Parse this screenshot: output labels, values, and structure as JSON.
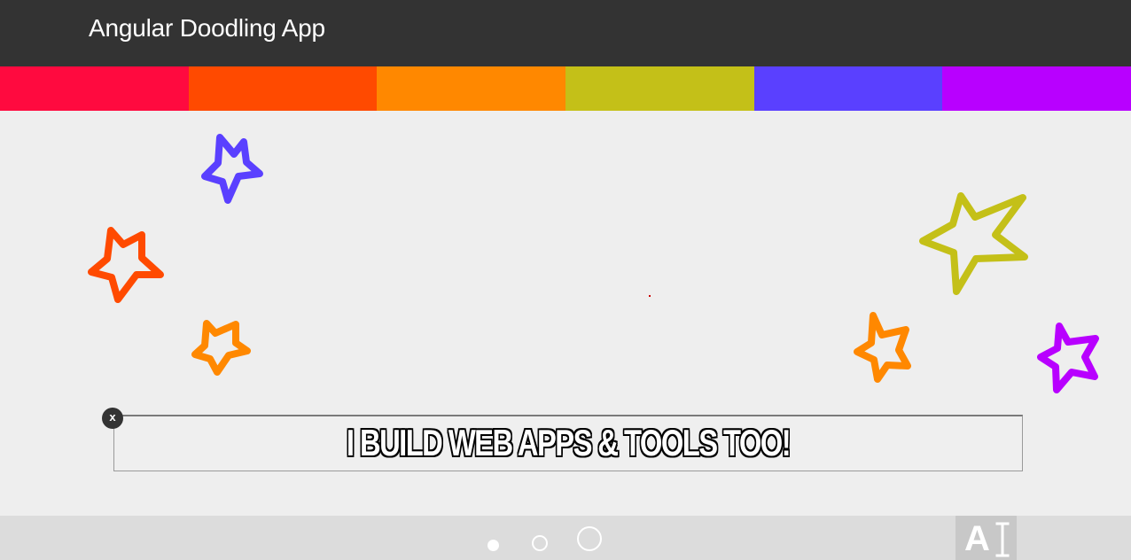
{
  "header": {
    "title": "Angular Doodling App"
  },
  "palette": {
    "colors": [
      "#ff0a3f",
      "#ff4a00",
      "#ff8800",
      "#c4c018",
      "#5a40ff",
      "#b800ff"
    ]
  },
  "canvas": {
    "strokes": [
      {
        "name": "star-blue",
        "color": "#5a40ff"
      },
      {
        "name": "star-red-orange",
        "color": "#ff4a00"
      },
      {
        "name": "star-orange-left",
        "color": "#ff8800"
      },
      {
        "name": "star-olive",
        "color": "#c4c018"
      },
      {
        "name": "star-orange-right",
        "color": "#ff8800"
      },
      {
        "name": "star-purple",
        "color": "#b800ff"
      }
    ]
  },
  "text_box": {
    "text": "I BUILD WEB APPS & TOOLS TOO!",
    "close_label": "x"
  },
  "toolbar": {
    "brush_sizes": [
      "small",
      "medium",
      "large"
    ],
    "text_tool_label": "A",
    "icons": {
      "text_tool": "text-cursor-icon",
      "close": "close-icon"
    }
  }
}
